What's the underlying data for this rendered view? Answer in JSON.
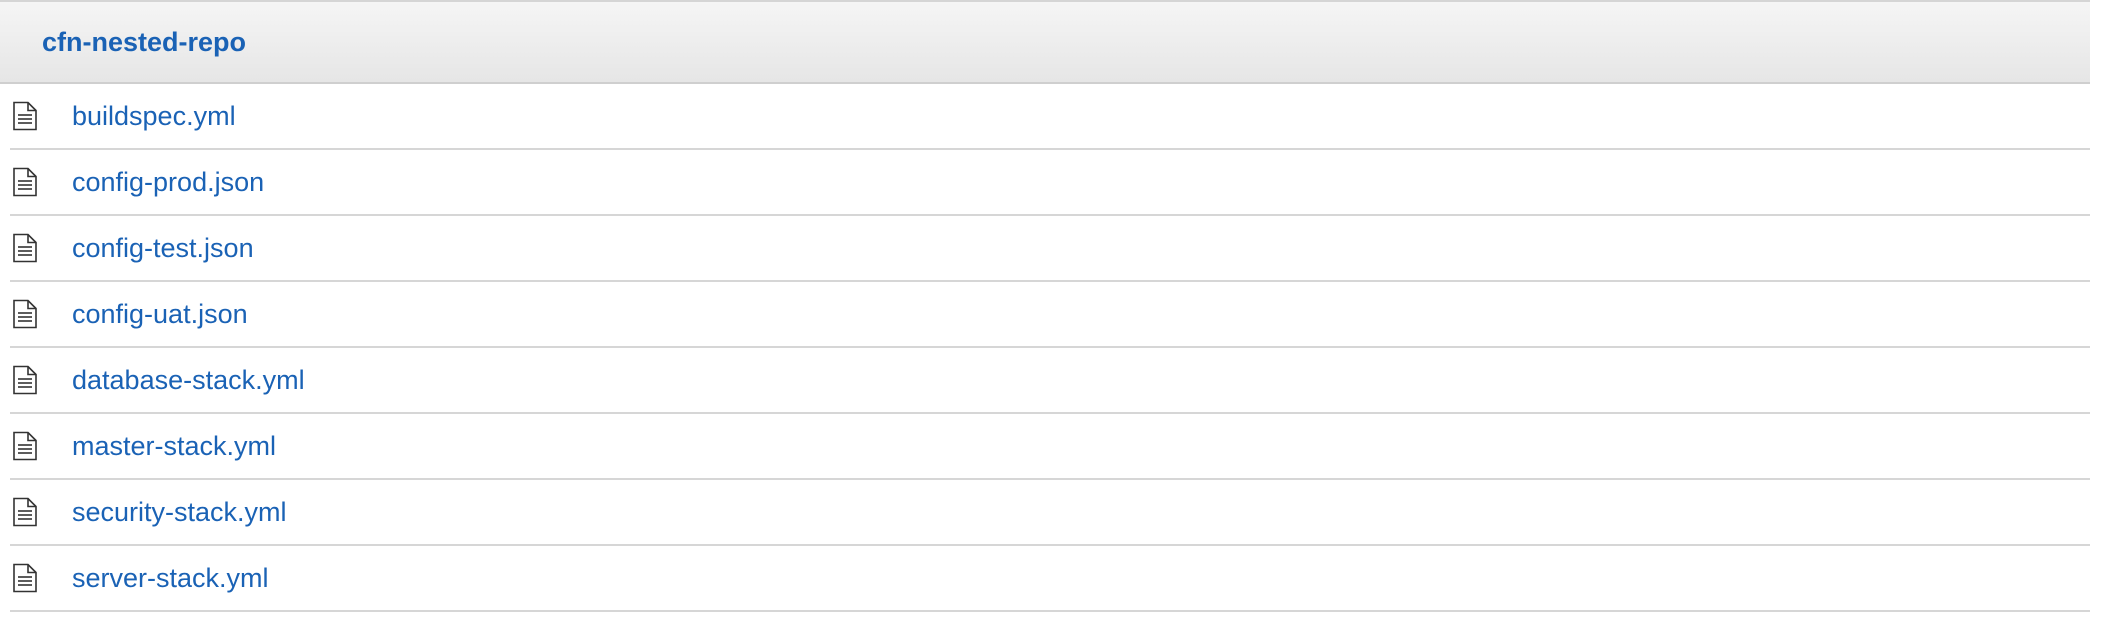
{
  "repo": {
    "name": "cfn-nested-repo"
  },
  "files": [
    {
      "name": "buildspec.yml",
      "icon": "file-text-icon"
    },
    {
      "name": "config-prod.json",
      "icon": "file-text-icon"
    },
    {
      "name": "config-test.json",
      "icon": "file-text-icon"
    },
    {
      "name": "config-uat.json",
      "icon": "file-text-icon"
    },
    {
      "name": "database-stack.yml",
      "icon": "file-text-icon"
    },
    {
      "name": "master-stack.yml",
      "icon": "file-text-icon"
    },
    {
      "name": "security-stack.yml",
      "icon": "file-text-icon"
    },
    {
      "name": "server-stack.yml",
      "icon": "file-text-icon"
    }
  ],
  "colors": {
    "link": "#1a62b5",
    "divider": "#d6d6d6"
  }
}
